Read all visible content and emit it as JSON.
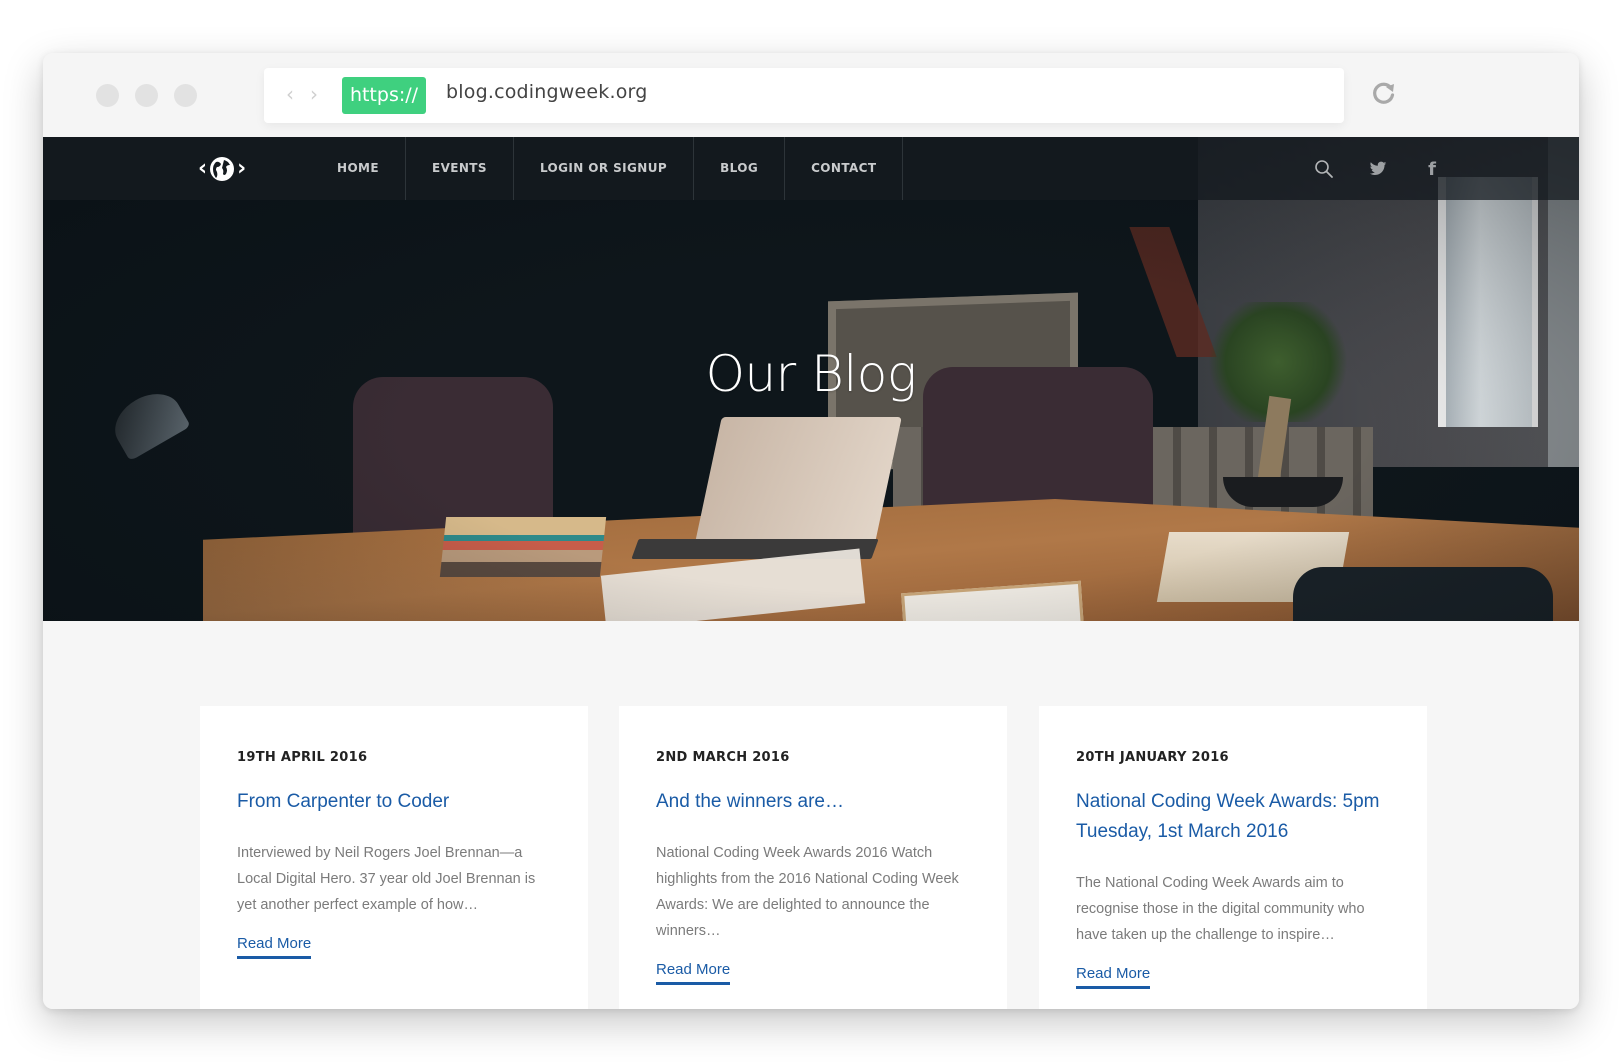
{
  "browser": {
    "https_label": "https://",
    "url": "blog.codingweek.org",
    "back_icon": "chevron-left-icon",
    "forward_icon": "chevron-right-icon",
    "reload_icon": "reload-icon"
  },
  "nav": {
    "logo_icon": "globe-code-icon",
    "items": [
      {
        "label": "HOME"
      },
      {
        "label": "EVENTS"
      },
      {
        "label": "LOGIN OR SIGNUP"
      },
      {
        "label": "BLOG"
      },
      {
        "label": "CONTACT"
      }
    ],
    "icons": [
      "search-icon",
      "twitter-icon",
      "facebook-icon"
    ],
    "facebook_glyph": "f"
  },
  "hero": {
    "title": "Our Blog"
  },
  "posts": [
    {
      "date": "19TH APRIL 2016",
      "title": "From Carpenter to Coder",
      "excerpt": "Interviewed by Neil Rogers Joel Brennan—a Local Digital Hero. 37 year old Joel Brennan is yet another perfect example of how…",
      "read_more": "Read More"
    },
    {
      "date": "2ND MARCH 2016",
      "title": "And the winners are…",
      "excerpt": "National Coding Week Awards 2016 Watch highlights from the 2016 National Coding Week Awards: We are delighted to announce the winners…",
      "read_more": "Read More"
    },
    {
      "date": "20TH JANUARY 2016",
      "title": "National Coding Week Awards: 5pm Tuesday, 1st March 2016",
      "excerpt": "The National Coding Week Awards aim to recognise those in the digital community who have taken up the challenge to inspire…",
      "read_more": "Read More"
    }
  ],
  "colors": {
    "https_badge": "#3fd07f",
    "link_blue": "#1a5ba6",
    "nav_bg": "#141a1f",
    "page_bg": "#f6f6f6"
  }
}
